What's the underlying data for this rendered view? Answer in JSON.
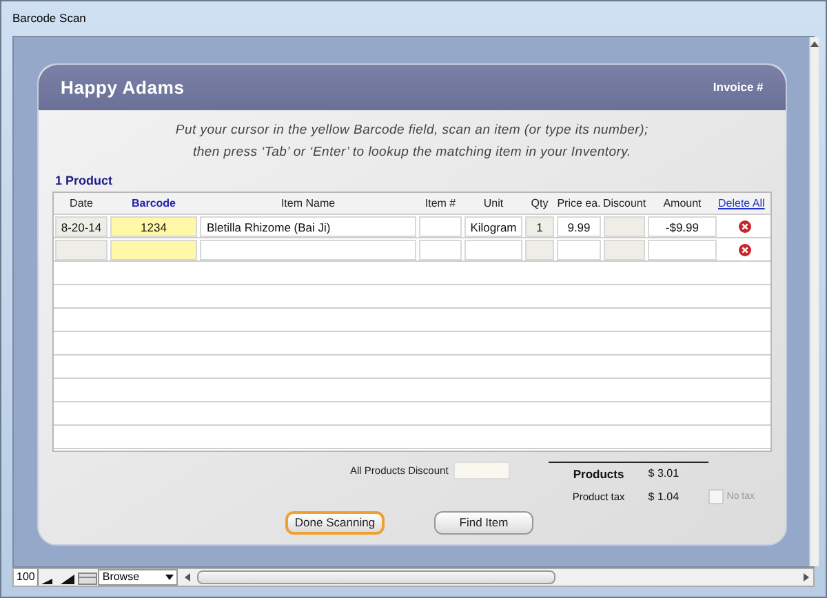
{
  "window": {
    "title": "Barcode Scan"
  },
  "header": {
    "customer": "Happy Adams",
    "invoice_label": "Invoice #"
  },
  "instructions": [
    "Put your cursor in the yellow Barcode field, scan an item (or type its number);",
    "then press ‘Tab’ or ‘Enter’ to lookup the matching item in your Inventory."
  ],
  "product_count": "1 Product",
  "table": {
    "columns": [
      "Date",
      "Barcode",
      "Item Name",
      "Item #",
      "Unit",
      "Qty",
      "Price ea.",
      "Discount",
      "Amount"
    ],
    "delete_all": "Delete All",
    "rows": [
      {
        "cells": [
          "8-20-14",
          "1234",
          "Bletilla Rhizome  (Bai Ji)",
          "",
          "Kilogram",
          "1",
          "9.99",
          "",
          "-$9.99"
        ]
      },
      {
        "cells": [
          "",
          "",
          "",
          "",
          "",
          "",
          "",
          "",
          ""
        ]
      }
    ]
  },
  "totals": {
    "discount_label": "All Products Discount",
    "products_label": "Products",
    "products_value": "$ 3.01",
    "tax_label": "Product tax",
    "tax_value": "$ 1.04",
    "no_tax": {
      "label": "No tax",
      "checked": false
    }
  },
  "buttons": [
    {
      "label": "Done Scanning",
      "focused": true
    },
    {
      "label": "Find Item",
      "focused": false
    }
  ],
  "status_bar": {
    "zoom": "100",
    "mode": "Browse"
  }
}
